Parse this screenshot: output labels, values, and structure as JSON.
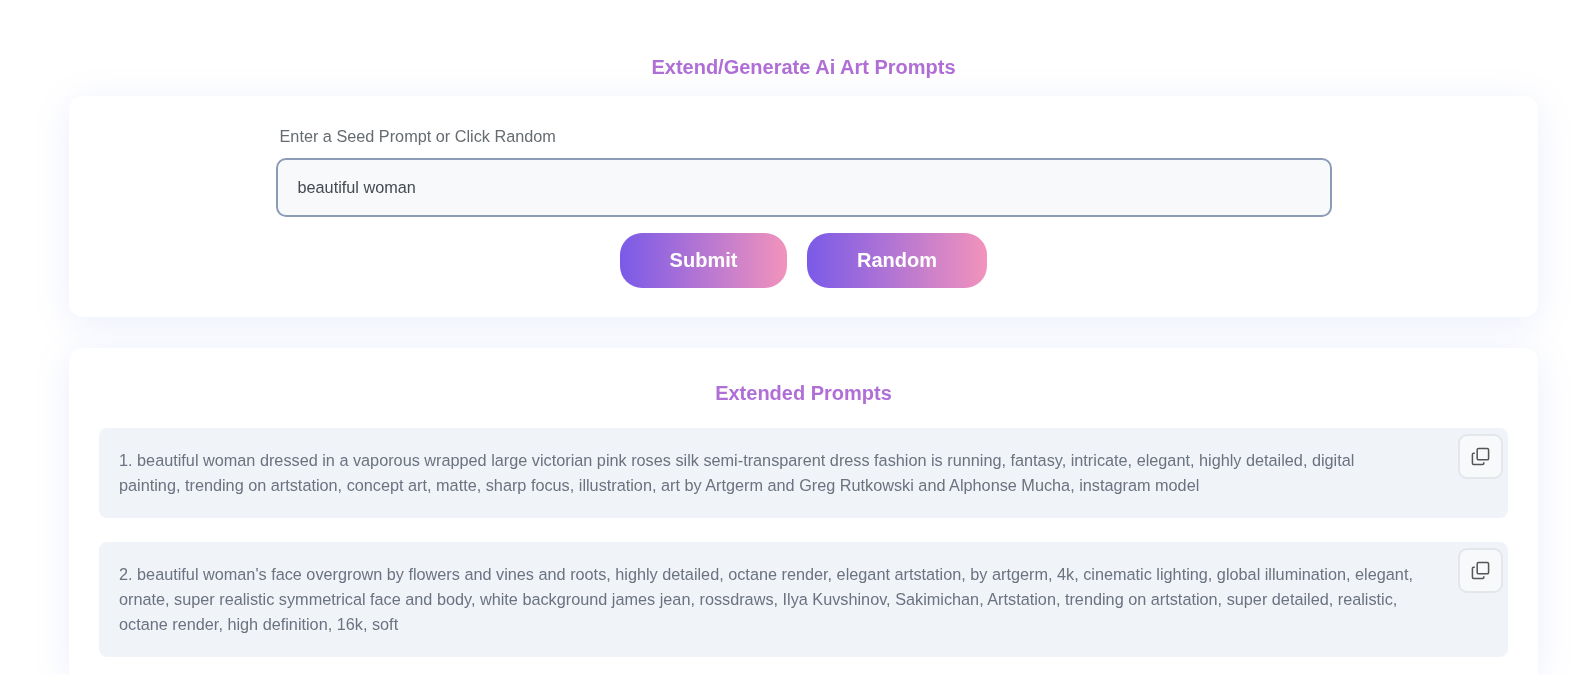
{
  "header": {
    "title": "Extend/Generate Ai Art Prompts"
  },
  "seed_form": {
    "label": "Enter a Seed Prompt or Click Random",
    "input": {
      "value": "beautiful woman"
    },
    "buttons": [
      {
        "label": "Submit"
      },
      {
        "label": "Random"
      }
    ]
  },
  "results": {
    "title": "Extended Prompts",
    "prompts": [
      {
        "text": "1. beautiful woman dressed in a vaporous wrapped large victorian pink roses silk semi-transparent dress fashion is running, fantasy, intricate, elegant, highly detailed, digital painting, trending on artstation, concept art, matte, sharp focus, illustration, art by Artgerm and Greg Rutkowski and Alphonse Mucha, instagram model"
      },
      {
        "text": "2. beautiful woman's face overgrown by flowers and vines and roots, highly detailed, octane render, elegant artstation, by artgerm, 4k, cinematic lighting, global illumination, elegant, ornate, super realistic symmetrical face and body, white background james jean, rossdraws, Ilya Kuvshinov, Sakimichan, Artstation, trending on artstation, super detailed, realistic, octane render, high definition, 16k, soft"
      }
    ]
  }
}
